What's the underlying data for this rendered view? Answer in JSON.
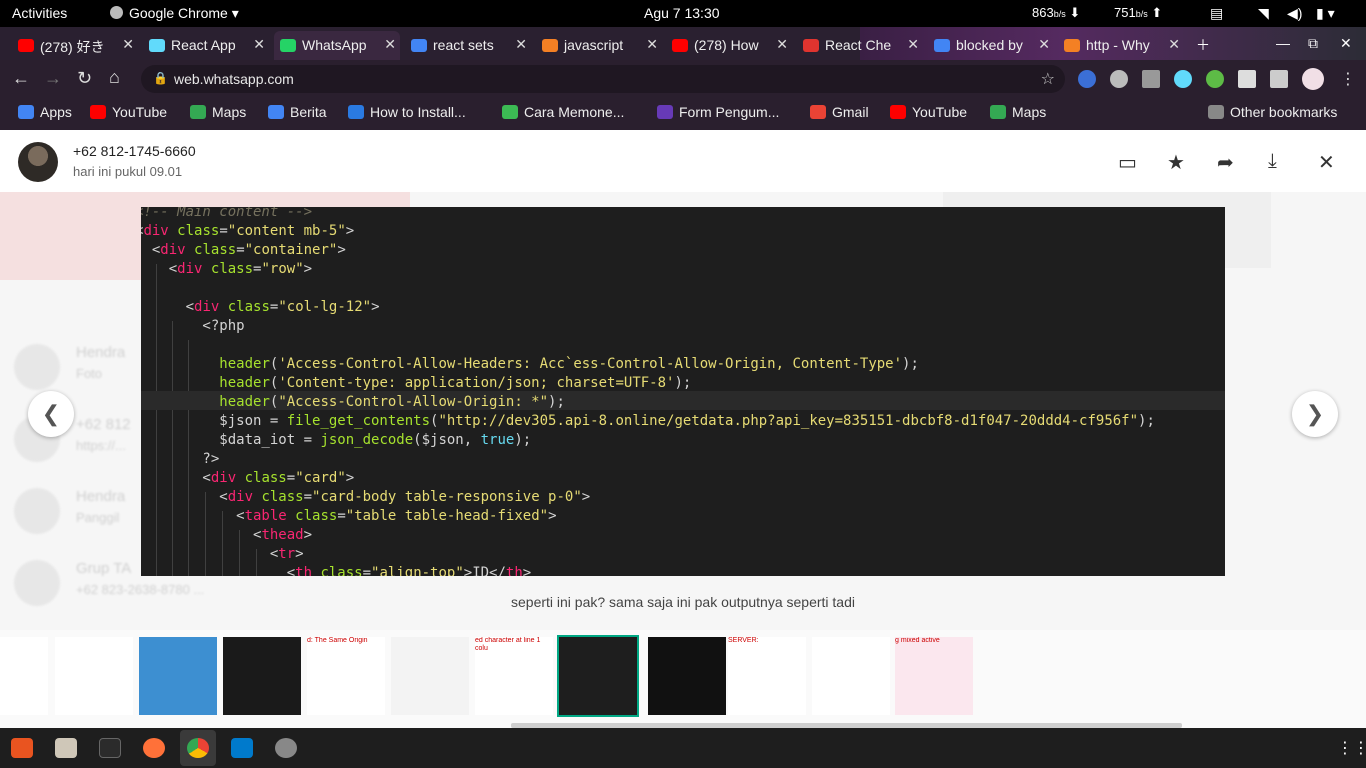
{
  "topbar": {
    "activities": "Activities",
    "app_name": "Google Chrome",
    "clock": "Agu 7  13:30",
    "net_down": "863",
    "net_down_unit": "b/s",
    "net_up": "751",
    "net_up_unit": "b/s"
  },
  "tabs": [
    {
      "label": "(278) 好き",
      "color": "#ff0000"
    },
    {
      "label": "React App",
      "color": "#61dafb"
    },
    {
      "label": "WhatsApp",
      "color": "#25d366"
    },
    {
      "label": "react sets",
      "color": "#4285f4"
    },
    {
      "label": "javascript",
      "color": "#f48024"
    },
    {
      "label": "(278) How",
      "color": "#ff0000"
    },
    {
      "label": "React Che",
      "color": "#e0342f"
    },
    {
      "label": "blocked by",
      "color": "#4285f4"
    },
    {
      "label": "http - Why",
      "color": "#f48024"
    }
  ],
  "omnibox": {
    "url": "web.whatsapp.com"
  },
  "bookmarks": [
    {
      "label": "Apps",
      "color": "#4285f4"
    },
    {
      "label": "YouTube",
      "color": "#ff0000"
    },
    {
      "label": "Maps",
      "color": "#34a853"
    },
    {
      "label": "Berita",
      "color": "#4285f4"
    },
    {
      "label": "How to Install...",
      "color": "#2a7ae2"
    },
    {
      "label": "Cara Memone...",
      "color": "#3cba54"
    },
    {
      "label": "Form Pengum...",
      "color": "#673ab7"
    },
    {
      "label": "Gmail",
      "color": "#ea4335"
    },
    {
      "label": "YouTube",
      "color": "#ff0000"
    },
    {
      "label": "Maps",
      "color": "#34a853"
    },
    {
      "label": "Other bookmarks",
      "color": "#888888"
    }
  ],
  "viewer": {
    "sender": "+62 812-1745-6660",
    "time": "hari ini pukul 09.01",
    "caption": "seperti ini pak? sama saja ini pak outputnya seperti tadi",
    "prev_icon": "chevron-left-icon",
    "next_icon": "chevron-right-icon"
  },
  "code": [
    {
      "t": "<!-- Main content -->"
    },
    {
      "t": "<div class=\"content mb-5\">"
    },
    {
      "t": "  <div class=\"container\">"
    },
    {
      "t": "    <div class=\"row\">"
    },
    {
      "t": ""
    },
    {
      "t": "      <div class=\"col-lg-12\">"
    },
    {
      "t": "        <?php"
    },
    {
      "t": ""
    },
    {
      "t": "          header('Access-Control-Allow-Headers: Acc`ess-Control-Allow-Origin, Content-Type');"
    },
    {
      "t": "          header('Content-type: application/json; charset=UTF-8');"
    },
    {
      "t": "          header(\"Access-Control-Allow-Origin: *\");"
    },
    {
      "t": "          $json = file_get_contents(\"http://dev305.api-8.online/getdata.php?api_key=835151-dbcbf8-d1f047-20ddd4-cf956f\");"
    },
    {
      "t": "          $data_iot = json_decode($json, true);"
    },
    {
      "t": "        ?>"
    },
    {
      "t": "        <div class=\"card\">"
    },
    {
      "t": "          <div class=\"card-body table-responsive p-0\">"
    },
    {
      "t": "            <table class=\"table table-head-fixed\">"
    },
    {
      "t": "              <thead>"
    },
    {
      "t": "                <tr>"
    },
    {
      "t": "                  <th class=\"align-top\">ID</th>"
    }
  ],
  "background_chats": [
    {
      "name": "Hendra",
      "preview": "Foto"
    },
    {
      "name": "+62 812",
      "preview": "https://..."
    },
    {
      "name": "Hendra",
      "preview": "Panggil"
    },
    {
      "name": "Grup TA",
      "preview": "+62 823-2638-8780 ..."
    }
  ],
  "thumbnails": [
    {
      "caption": ""
    },
    {
      "caption": ""
    },
    {
      "caption": ""
    },
    {
      "caption": ""
    },
    {
      "caption": "d: The Same Origin"
    },
    {
      "caption": ""
    },
    {
      "caption": "ed character at line 1 colu"
    },
    {
      "caption": ""
    },
    {
      "caption": ""
    },
    {
      "caption": "SERVER:"
    },
    {
      "caption": ""
    },
    {
      "caption": "g mixed active"
    }
  ]
}
